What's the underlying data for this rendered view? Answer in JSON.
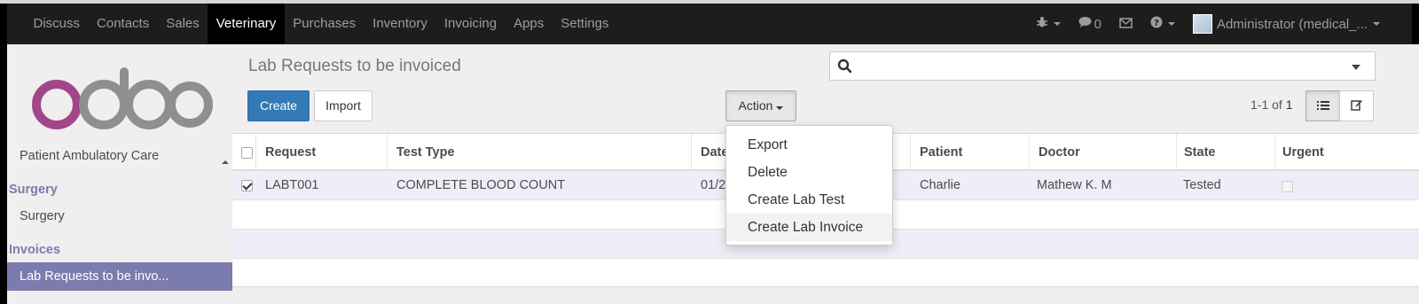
{
  "topbar": {
    "menu": [
      "Discuss",
      "Contacts",
      "Sales",
      "Veterinary",
      "Purchases",
      "Inventory",
      "Invoicing",
      "Apps",
      "Settings"
    ],
    "active_menu": "Veterinary",
    "messages_count": "0",
    "user_label": "Administrator (medical_..."
  },
  "sidebar": {
    "logo_text": "odoo",
    "items": [
      {
        "label": "Patient Ambulatory Care"
      },
      {
        "label": "Surgery"
      },
      {
        "label": "Surgery"
      },
      {
        "label": "Invoices"
      },
      {
        "label": "Lab Requests to be invo..."
      }
    ]
  },
  "control_panel": {
    "title": "Lab Requests to be invoiced",
    "search_placeholder": "",
    "create_label": "Create",
    "import_label": "Import",
    "action_label": "Action",
    "pager_range": "1-1 of ",
    "pager_total": "1"
  },
  "table": {
    "headers": [
      "Request",
      "Test Type",
      "Date",
      "Patient",
      "Doctor",
      "State",
      "Urgent"
    ],
    "rows": [
      {
        "request": "LABT001",
        "test_type": "COMPLETE BLOOD COUNT",
        "date": "01/2",
        "patient": "Charlie",
        "doctor": "Mathew K. M",
        "state": "Tested",
        "urgent": false,
        "selected": true
      }
    ]
  },
  "action_menu": {
    "items": [
      "Export",
      "Delete",
      "Create Lab Test",
      "Create Lab Invoice"
    ],
    "hovered": "Create Lab Invoice"
  },
  "colors": {
    "brand_purple": "#7c7bad",
    "primary_blue": "#337ab7",
    "navbar": "#1d1d1d"
  }
}
